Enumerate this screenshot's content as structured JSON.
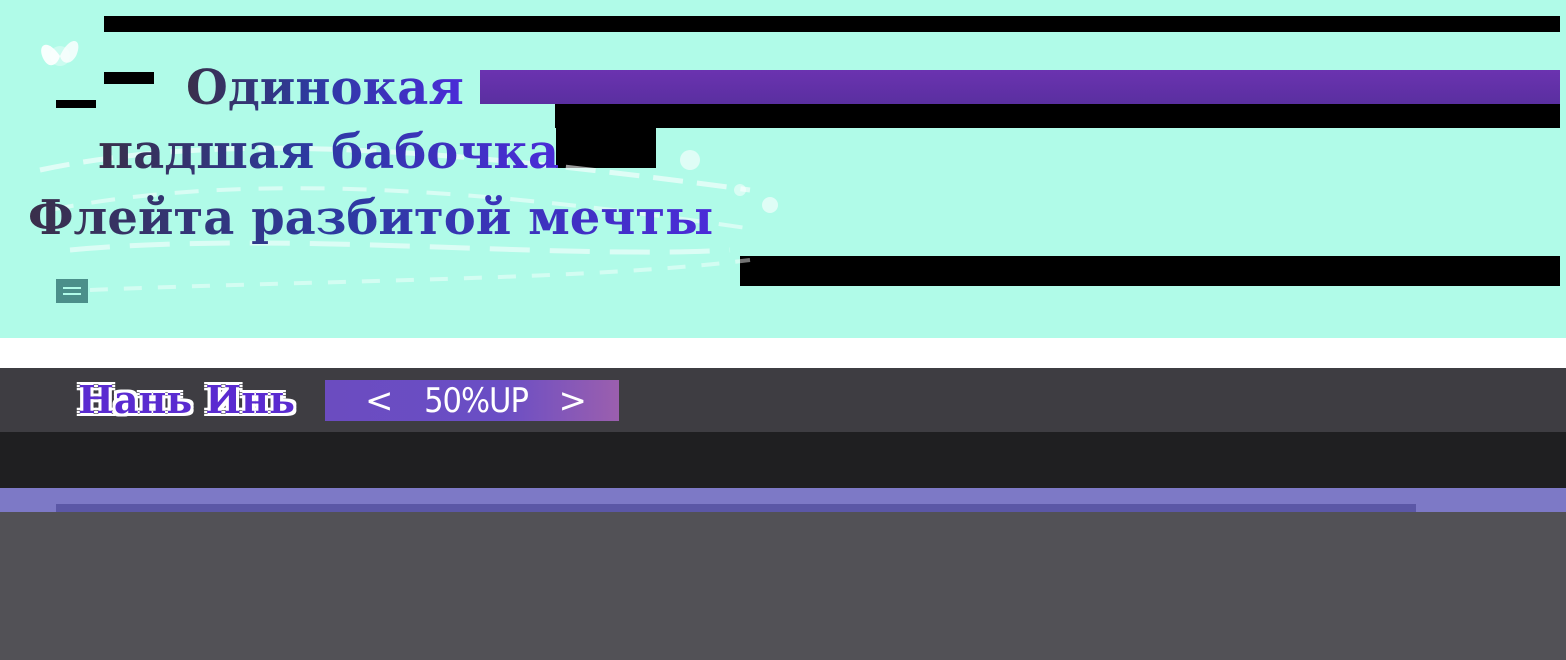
{
  "banner": {
    "title_lines": [
      "Одинокая",
      "падшая бабочка",
      "Флейта разбитой мечты"
    ]
  },
  "character": {
    "name": "Нань Инь"
  },
  "rate": {
    "prev_label": "<",
    "value": "50%UP",
    "next_label": ">"
  },
  "colors": {
    "banner_bg": "#b0fbe8",
    "accent_purple": "#6b33b0",
    "lavender": "#7d79c6",
    "dark": "#3e3d42"
  },
  "icons": [
    "butterfly-icon",
    "menu-icon"
  ]
}
